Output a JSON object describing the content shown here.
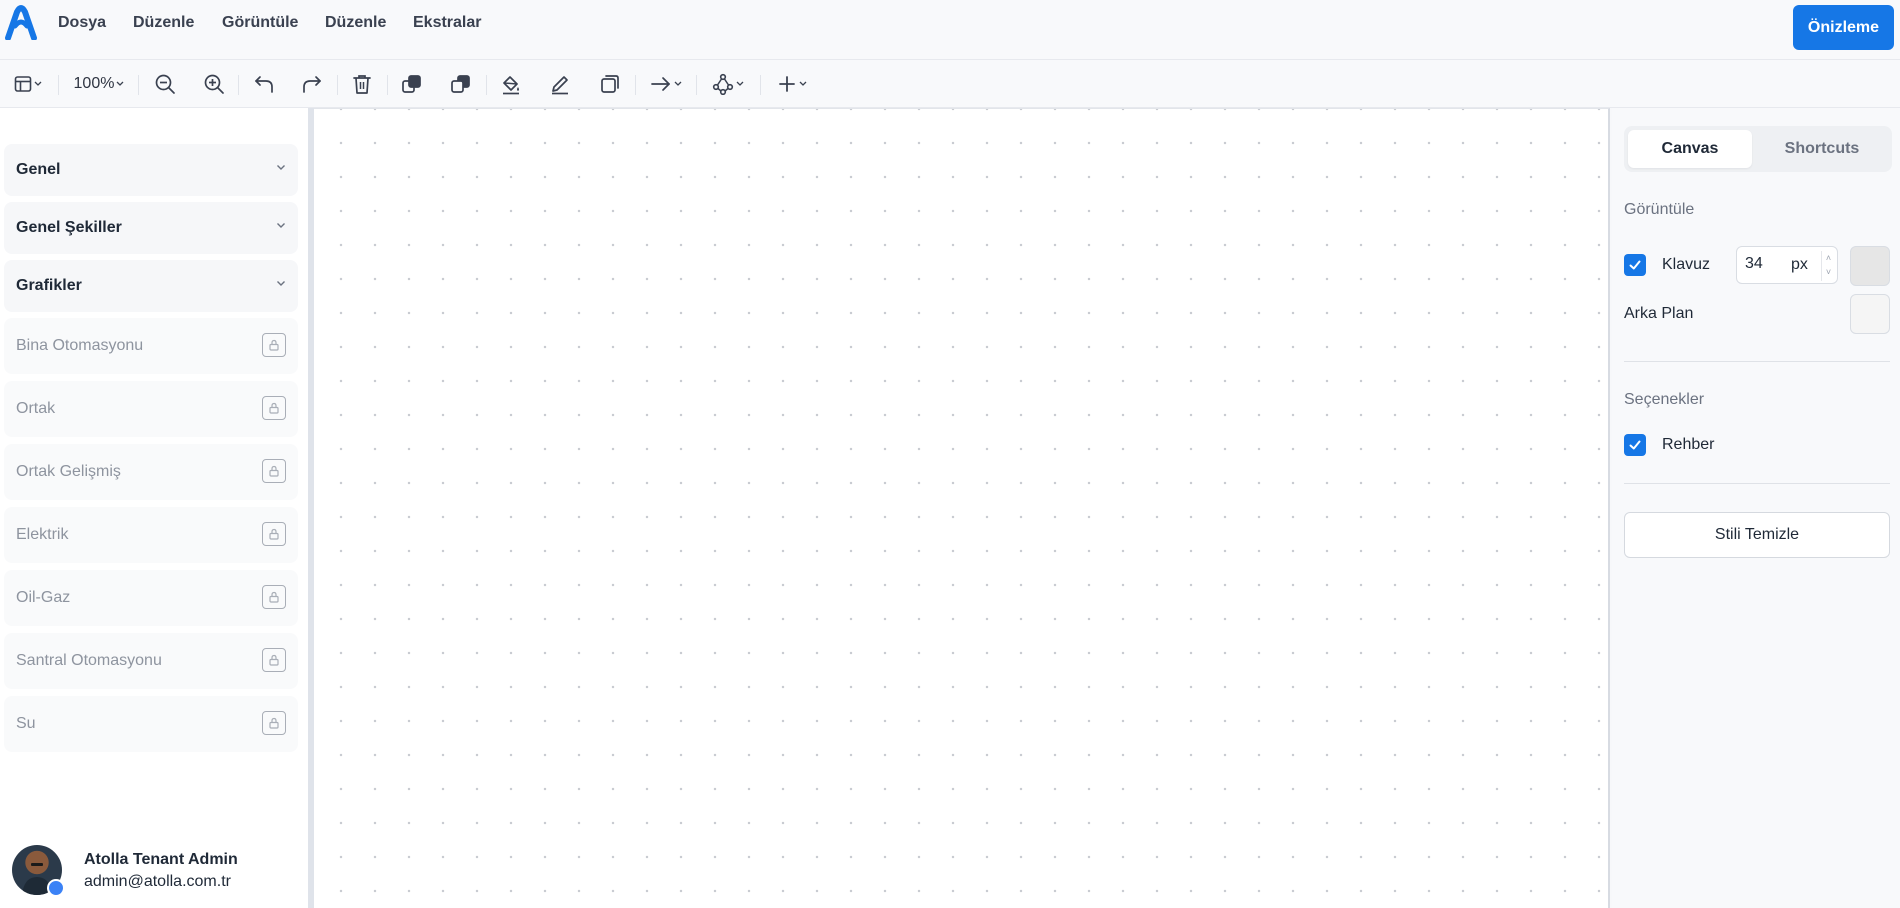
{
  "menu": {
    "items": [
      "Dosya",
      "Düzenle",
      "Görüntüle",
      "Düzenle",
      "Ekstralar"
    ],
    "preview_label": "Önizleme"
  },
  "toolbar": {
    "zoom": "100%"
  },
  "sidebar": {
    "categories": [
      {
        "label": "Genel"
      },
      {
        "label": "Genel Şekiller"
      },
      {
        "label": "Grafikler"
      }
    ],
    "libraries": [
      {
        "label": "Bina Otomasyonu"
      },
      {
        "label": "Ortak"
      },
      {
        "label": "Ortak Gelişmiş"
      },
      {
        "label": "Elektrik"
      },
      {
        "label": "Oil-Gaz"
      },
      {
        "label": "Santral Otomasyonu"
      },
      {
        "label": "Su"
      }
    ],
    "user": {
      "name": "Atolla Tenant Admin",
      "email": "admin@atolla.com.tr"
    }
  },
  "panel": {
    "tabs": {
      "canvas": "Canvas",
      "shortcuts": "Shortcuts"
    },
    "view_section": "Görüntüle",
    "grid_label": "Klavuz",
    "grid_size": "34",
    "grid_unit": "px",
    "background_label": "Arka Plan",
    "options_section": "Seçenekler",
    "guide_label": "Rehber",
    "clear_style_label": "Stili Temizle"
  },
  "colors": {
    "accent": "#1677e6",
    "grid_swatch": "#e6e6e6",
    "background_swatch": "#f5f5f5"
  }
}
